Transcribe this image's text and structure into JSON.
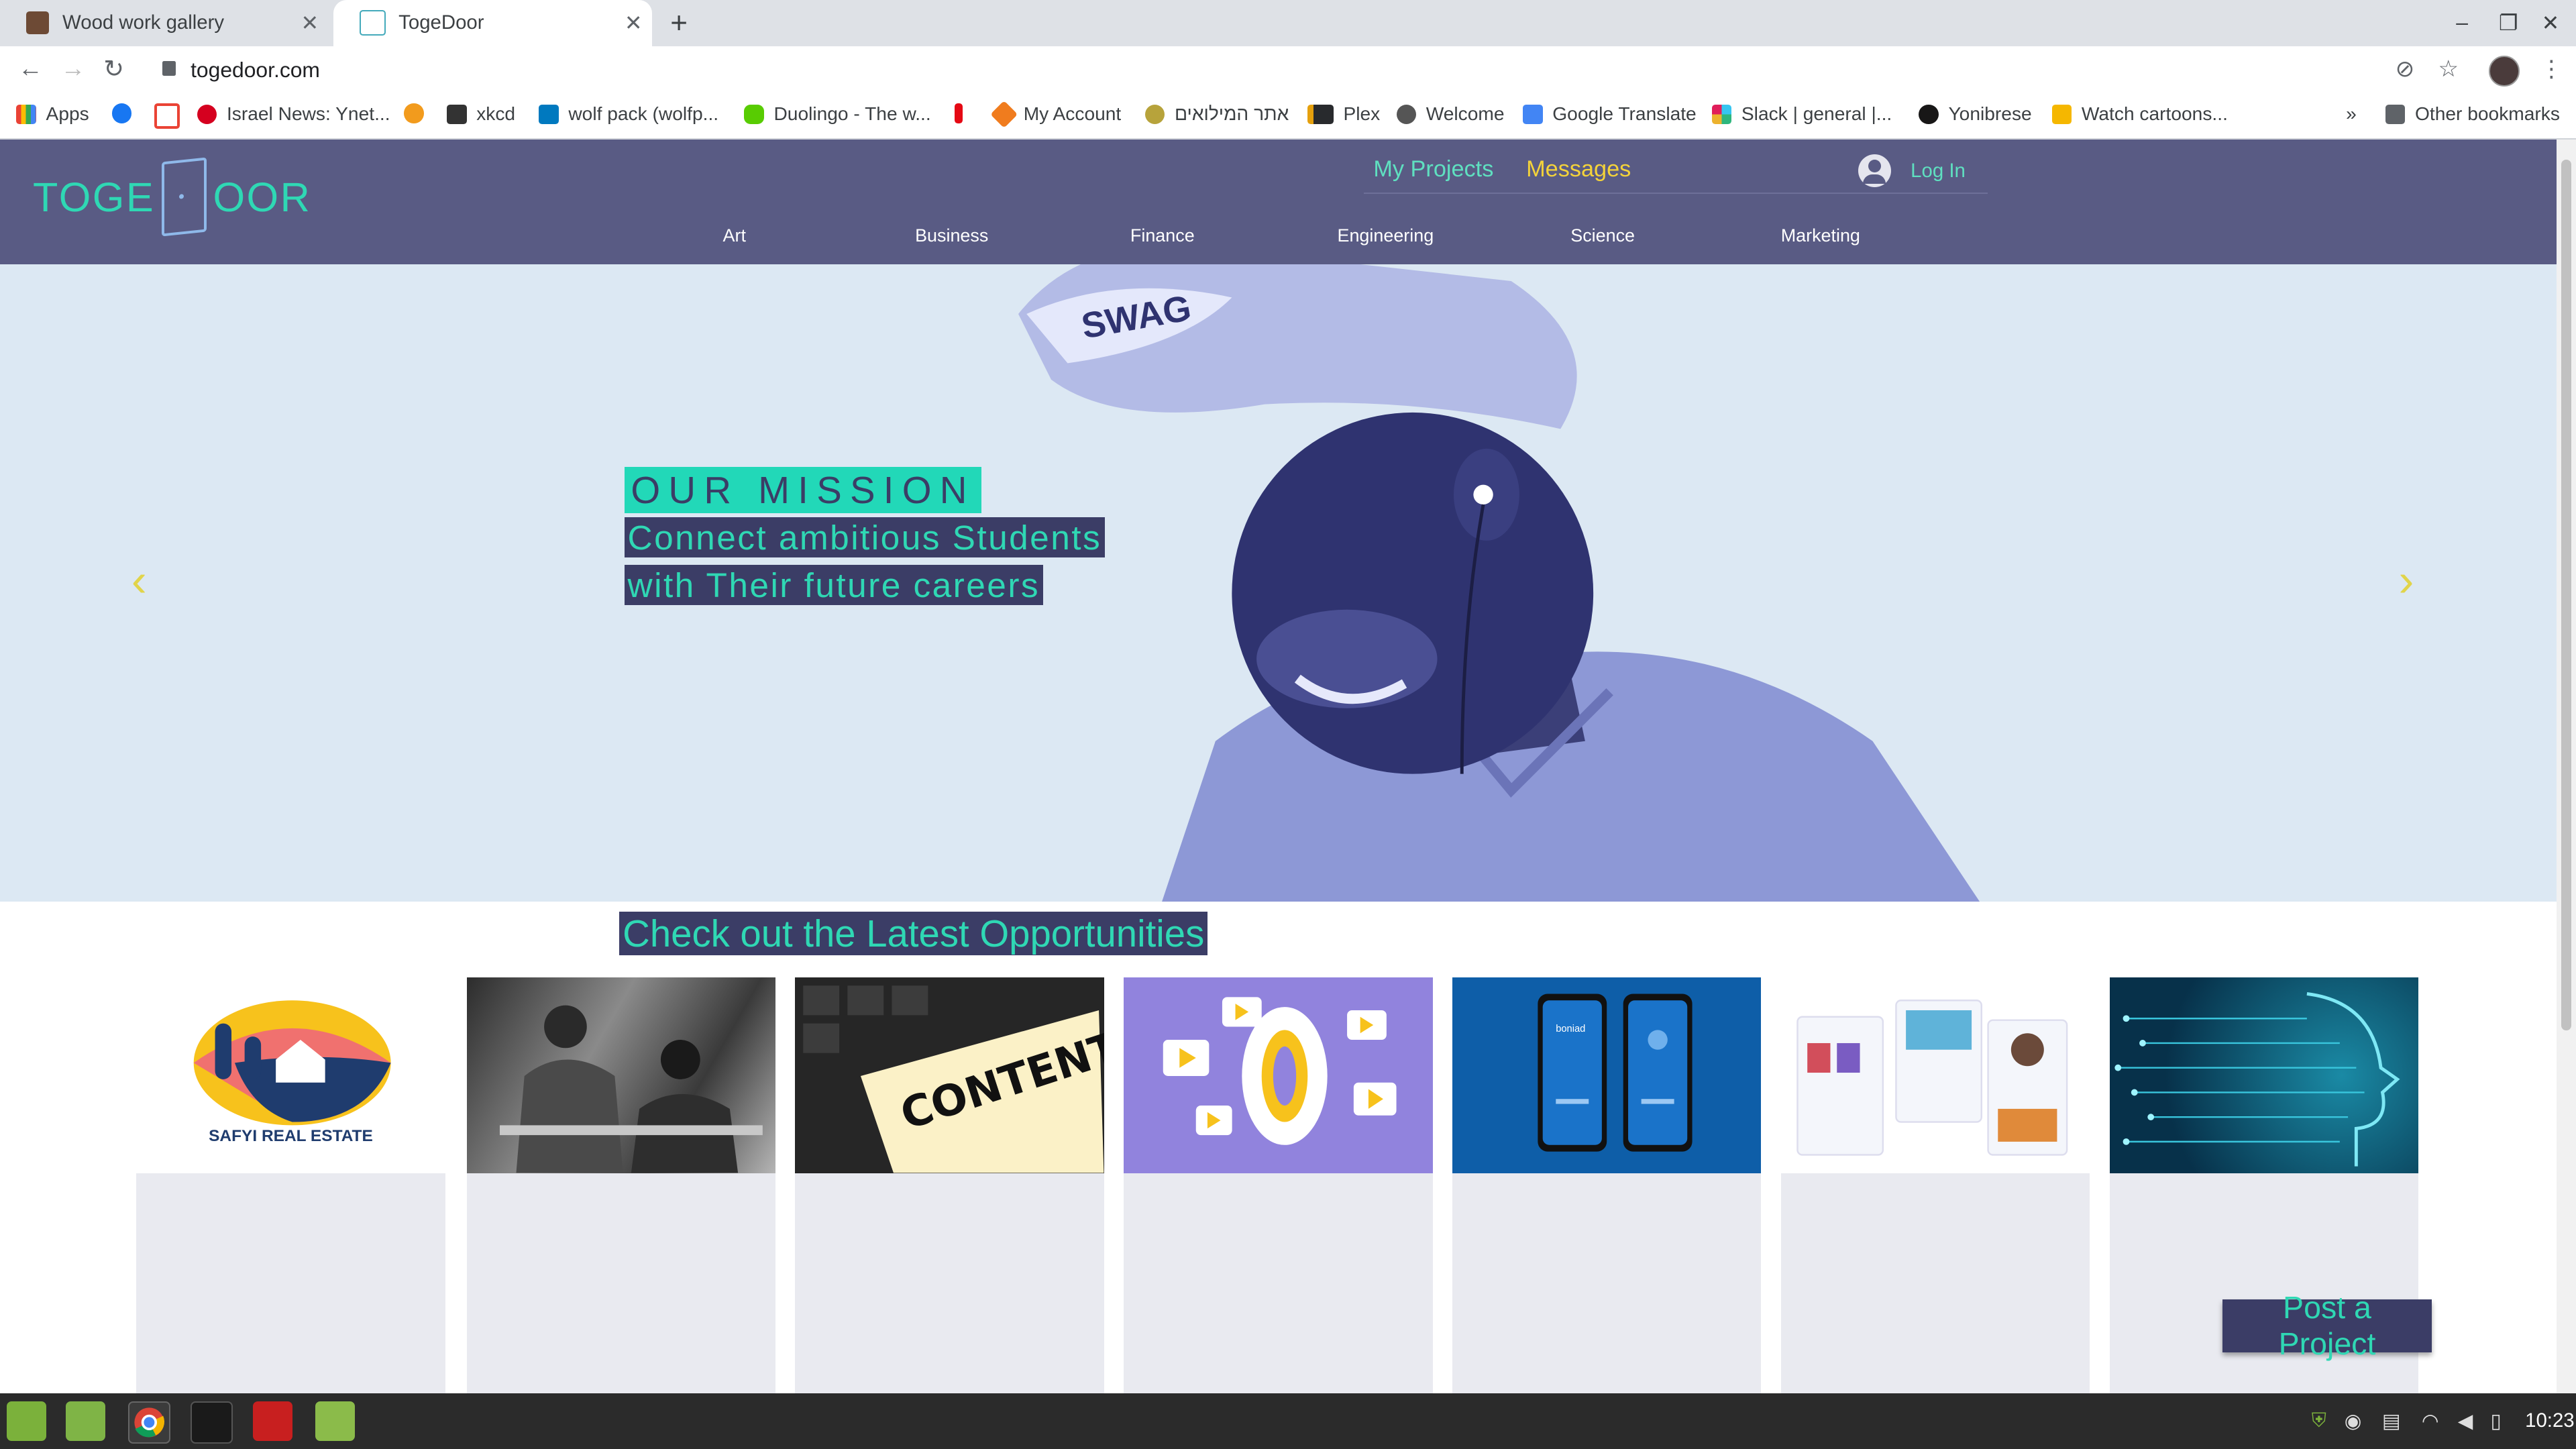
{
  "browser": {
    "tabs": [
      {
        "title": "Wood work gallery",
        "active": false
      },
      {
        "title": "TogeDoor",
        "active": true
      }
    ],
    "url": "togedoor.com",
    "bookmarks": [
      {
        "label": "Apps",
        "icon": "apps-grid-icon"
      },
      {
        "label": "",
        "icon": "facebook-icon"
      },
      {
        "label": "",
        "icon": "gmail-icon"
      },
      {
        "label": "Israel News: Ynet...",
        "icon": "ynet-icon"
      },
      {
        "label": "",
        "icon": "sun-icon"
      },
      {
        "label": "xkcd",
        "icon": "xkcd-icon"
      },
      {
        "label": "wolf pack (wolfp...",
        "icon": "trello-icon"
      },
      {
        "label": "Duolingo - The w...",
        "icon": "duolingo-icon"
      },
      {
        "label": "",
        "icon": "netflix-icon"
      },
      {
        "label": "My Account",
        "icon": "account-icon"
      },
      {
        "label": "אתר המילואים",
        "icon": "idf-icon"
      },
      {
        "label": "Plex",
        "icon": "plex-icon"
      },
      {
        "label": "Welcome",
        "icon": "globe-icon"
      },
      {
        "label": "Google Translate",
        "icon": "translate-icon"
      },
      {
        "label": "Slack | general |...",
        "icon": "slack-icon"
      },
      {
        "label": "Yonibrese",
        "icon": "github-icon"
      },
      {
        "label": "Watch cartoons...",
        "icon": "cartoon-icon"
      }
    ],
    "more_bookmarks": "»",
    "other_bookmarks": "Other bookmarks"
  },
  "site": {
    "logo_left": "TOGE",
    "logo_right": "OOR",
    "nav": {
      "my_projects": "My Projects",
      "messages": "Messages",
      "login": "Log In"
    },
    "categories": [
      "Art",
      "Business",
      "Finance",
      "Engineering",
      "Science",
      "Marketing"
    ],
    "hero": {
      "line1": "OUR MISSION",
      "line2": "Connect ambitious Students",
      "line3": "with Their future careers",
      "prev_arrow": "‹",
      "next_arrow": "›"
    },
    "opportunities_title": "Check out the Latest Opportunities",
    "cards": [
      {
        "image": "safyi-real-estate-logo",
        "caption": "SAFYI REAL ESTATE"
      },
      {
        "image": "engineers-workshop-photo"
      },
      {
        "image": "content-keyboard-photo",
        "caption": "CONTENT"
      },
      {
        "image": "social-media-video-illustration"
      },
      {
        "image": "banking-app-mockup",
        "caption": "boniad"
      },
      {
        "image": "social-app-screens"
      },
      {
        "image": "ai-circuit-face"
      }
    ],
    "post_button": "Post a Project"
  },
  "taskbar": {
    "clock": "10:23"
  }
}
